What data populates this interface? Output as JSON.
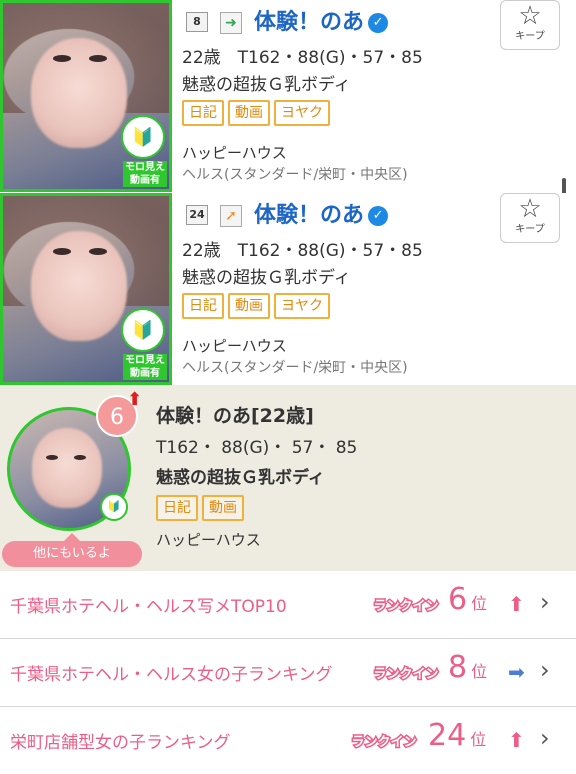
{
  "cards": [
    {
      "rank": "8",
      "trend_icon": "right-arrow",
      "trend_color": "#2fa84f",
      "name": "体験！のあ",
      "stats": "22歳　T162・88(G)・57・85",
      "catch": "魅惑の超抜Ｇ乳ボディ",
      "tags": [
        "日記",
        "動画",
        "ヨヤク"
      ],
      "shop": "ハッピーハウス",
      "area": "ヘルス(スタンダード/栄町・中央区)",
      "badge_label": "モロ見え動画有",
      "keep_label": "キープ"
    },
    {
      "rank": "24",
      "trend_icon": "up-right-arrow",
      "trend_color": "#f08c1a",
      "name": "体験！のあ",
      "stats": "22歳　T162・88(G)・57・85",
      "catch": "魅惑の超抜Ｇ乳ボディ",
      "tags": [
        "日記",
        "動画",
        "ヨヤク"
      ],
      "shop": "ハッピーハウス",
      "area": "ヘルス(スタンダード/栄町・中央区)",
      "badge_label": "モロ見え動画有",
      "keep_label": "キープ"
    }
  ],
  "featured": {
    "rank": "6",
    "title": "体験！のあ[22歳]",
    "stats": "T162・ 88(G)・ 57・ 85",
    "catch": "魅惑の超抜Ｇ乳ボディ",
    "tags": [
      "日記",
      "動画"
    ],
    "shop": "ハッピーハウス",
    "more_label": "他にもいるよ"
  },
  "rankings": [
    {
      "title": "千葉県ホテヘル・ヘルス写メTOP10",
      "badge": "ランクイン",
      "position": "6",
      "unit": "位",
      "trend": "up",
      "trend_color": "#ec5e86"
    },
    {
      "title": "千葉県ホテヘル・ヘルス女の子ランキング",
      "badge": "ランクイン",
      "position": "8",
      "unit": "位",
      "trend": "right",
      "trend_color": "#4a7fd0"
    },
    {
      "title": "栄町店舗型女の子ランキング",
      "badge": "ランクイン",
      "position": "24",
      "unit": "位",
      "trend": "up",
      "trend_color": "#ec5e86"
    }
  ]
}
